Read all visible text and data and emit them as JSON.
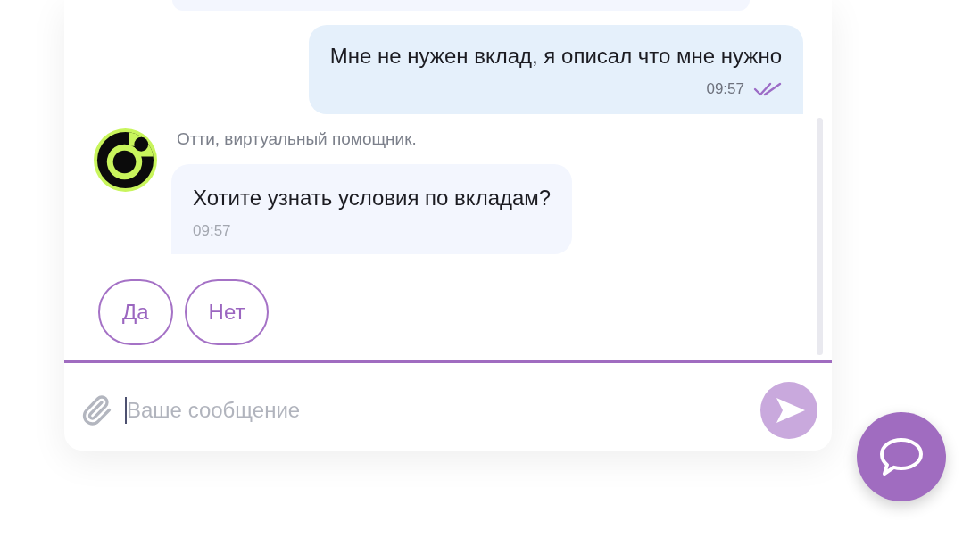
{
  "chat": {
    "messages": [
      {
        "kind": "bot"
      },
      {
        "kind": "user",
        "text": "Мне не нужен вклад, я описал что мне нужно",
        "time": "09:57",
        "read": true
      },
      {
        "kind": "bot",
        "author": "Отти, виртуальный помощник.",
        "text": "Хотите узнать условия по вкладам?",
        "time": "09:57"
      }
    ],
    "quick_replies": [
      "Да",
      "Нет"
    ],
    "composer": {
      "placeholder": "Ваше сообщение",
      "send_disabled": true
    }
  }
}
